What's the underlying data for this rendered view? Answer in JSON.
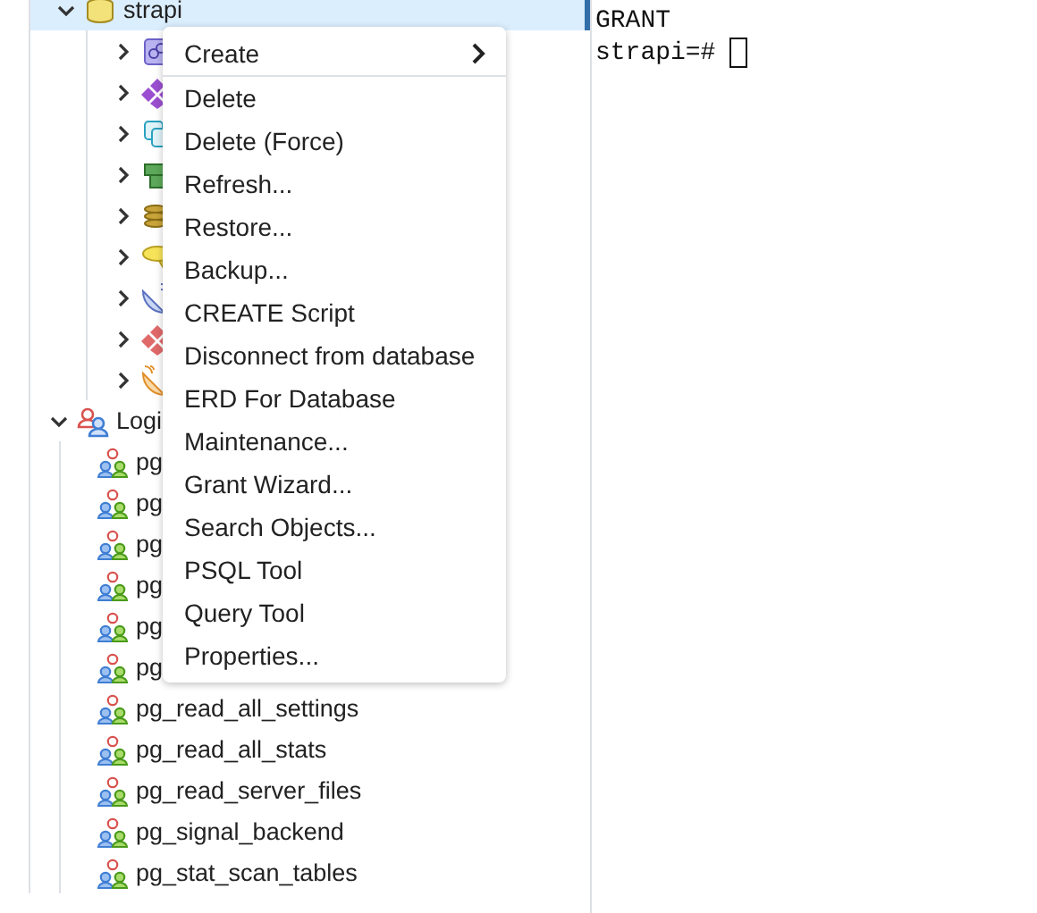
{
  "tree": {
    "database": {
      "label": "strapi",
      "selected": true,
      "expanded": true,
      "children": [
        {
          "kind": "cast",
          "expanded": false
        },
        {
          "kind": "catalog",
          "expanded": false
        },
        {
          "kind": "event-trigger",
          "expanded": false
        },
        {
          "kind": "extension",
          "expanded": false
        },
        {
          "kind": "foreign-data",
          "expanded": false
        },
        {
          "kind": "language",
          "expanded": false
        },
        {
          "kind": "publication",
          "expanded": false
        },
        {
          "kind": "schema",
          "expanded": false
        },
        {
          "kind": "subscription",
          "expanded": false
        }
      ]
    },
    "login_roles": {
      "label": "Logi",
      "selected": false,
      "expanded": true,
      "children": [
        {
          "label": "pg"
        },
        {
          "label": "pg"
        },
        {
          "label": "pg"
        },
        {
          "label": "pg"
        },
        {
          "label": "pg"
        },
        {
          "label": "pg"
        },
        {
          "label": "pg_read_all_settings"
        },
        {
          "label": "pg_read_all_stats"
        },
        {
          "label": "pg_read_server_files"
        },
        {
          "label": "pg_signal_backend"
        },
        {
          "label": "pg_stat_scan_tables"
        }
      ]
    }
  },
  "context_menu": {
    "items": [
      {
        "label": "Create",
        "submenu": true,
        "separator_after": true
      },
      {
        "label": "Delete",
        "submenu": false,
        "separator_after": false
      },
      {
        "label": "Delete (Force)",
        "submenu": false,
        "separator_after": false
      },
      {
        "label": "Refresh...",
        "submenu": false,
        "separator_after": false
      },
      {
        "label": "Restore...",
        "submenu": false,
        "separator_after": false
      },
      {
        "label": "Backup...",
        "submenu": false,
        "separator_after": false
      },
      {
        "label": "CREATE Script",
        "submenu": false,
        "separator_after": false
      },
      {
        "label": "Disconnect from database",
        "submenu": false,
        "separator_after": false
      },
      {
        "label": "ERD For Database",
        "submenu": false,
        "separator_after": false
      },
      {
        "label": "Maintenance...",
        "submenu": false,
        "separator_after": false
      },
      {
        "label": "Grant Wizard...",
        "submenu": false,
        "separator_after": false
      },
      {
        "label": "Search Objects...",
        "submenu": false,
        "separator_after": false
      },
      {
        "label": "PSQL Tool",
        "submenu": false,
        "separator_after": false
      },
      {
        "label": "Query Tool",
        "submenu": false,
        "separator_after": false
      },
      {
        "label": "Properties...",
        "submenu": false,
        "separator_after": false
      }
    ]
  },
  "terminal": {
    "lines": [
      "GRANT"
    ],
    "prompt": "strapi=#",
    "cursor": true
  }
}
